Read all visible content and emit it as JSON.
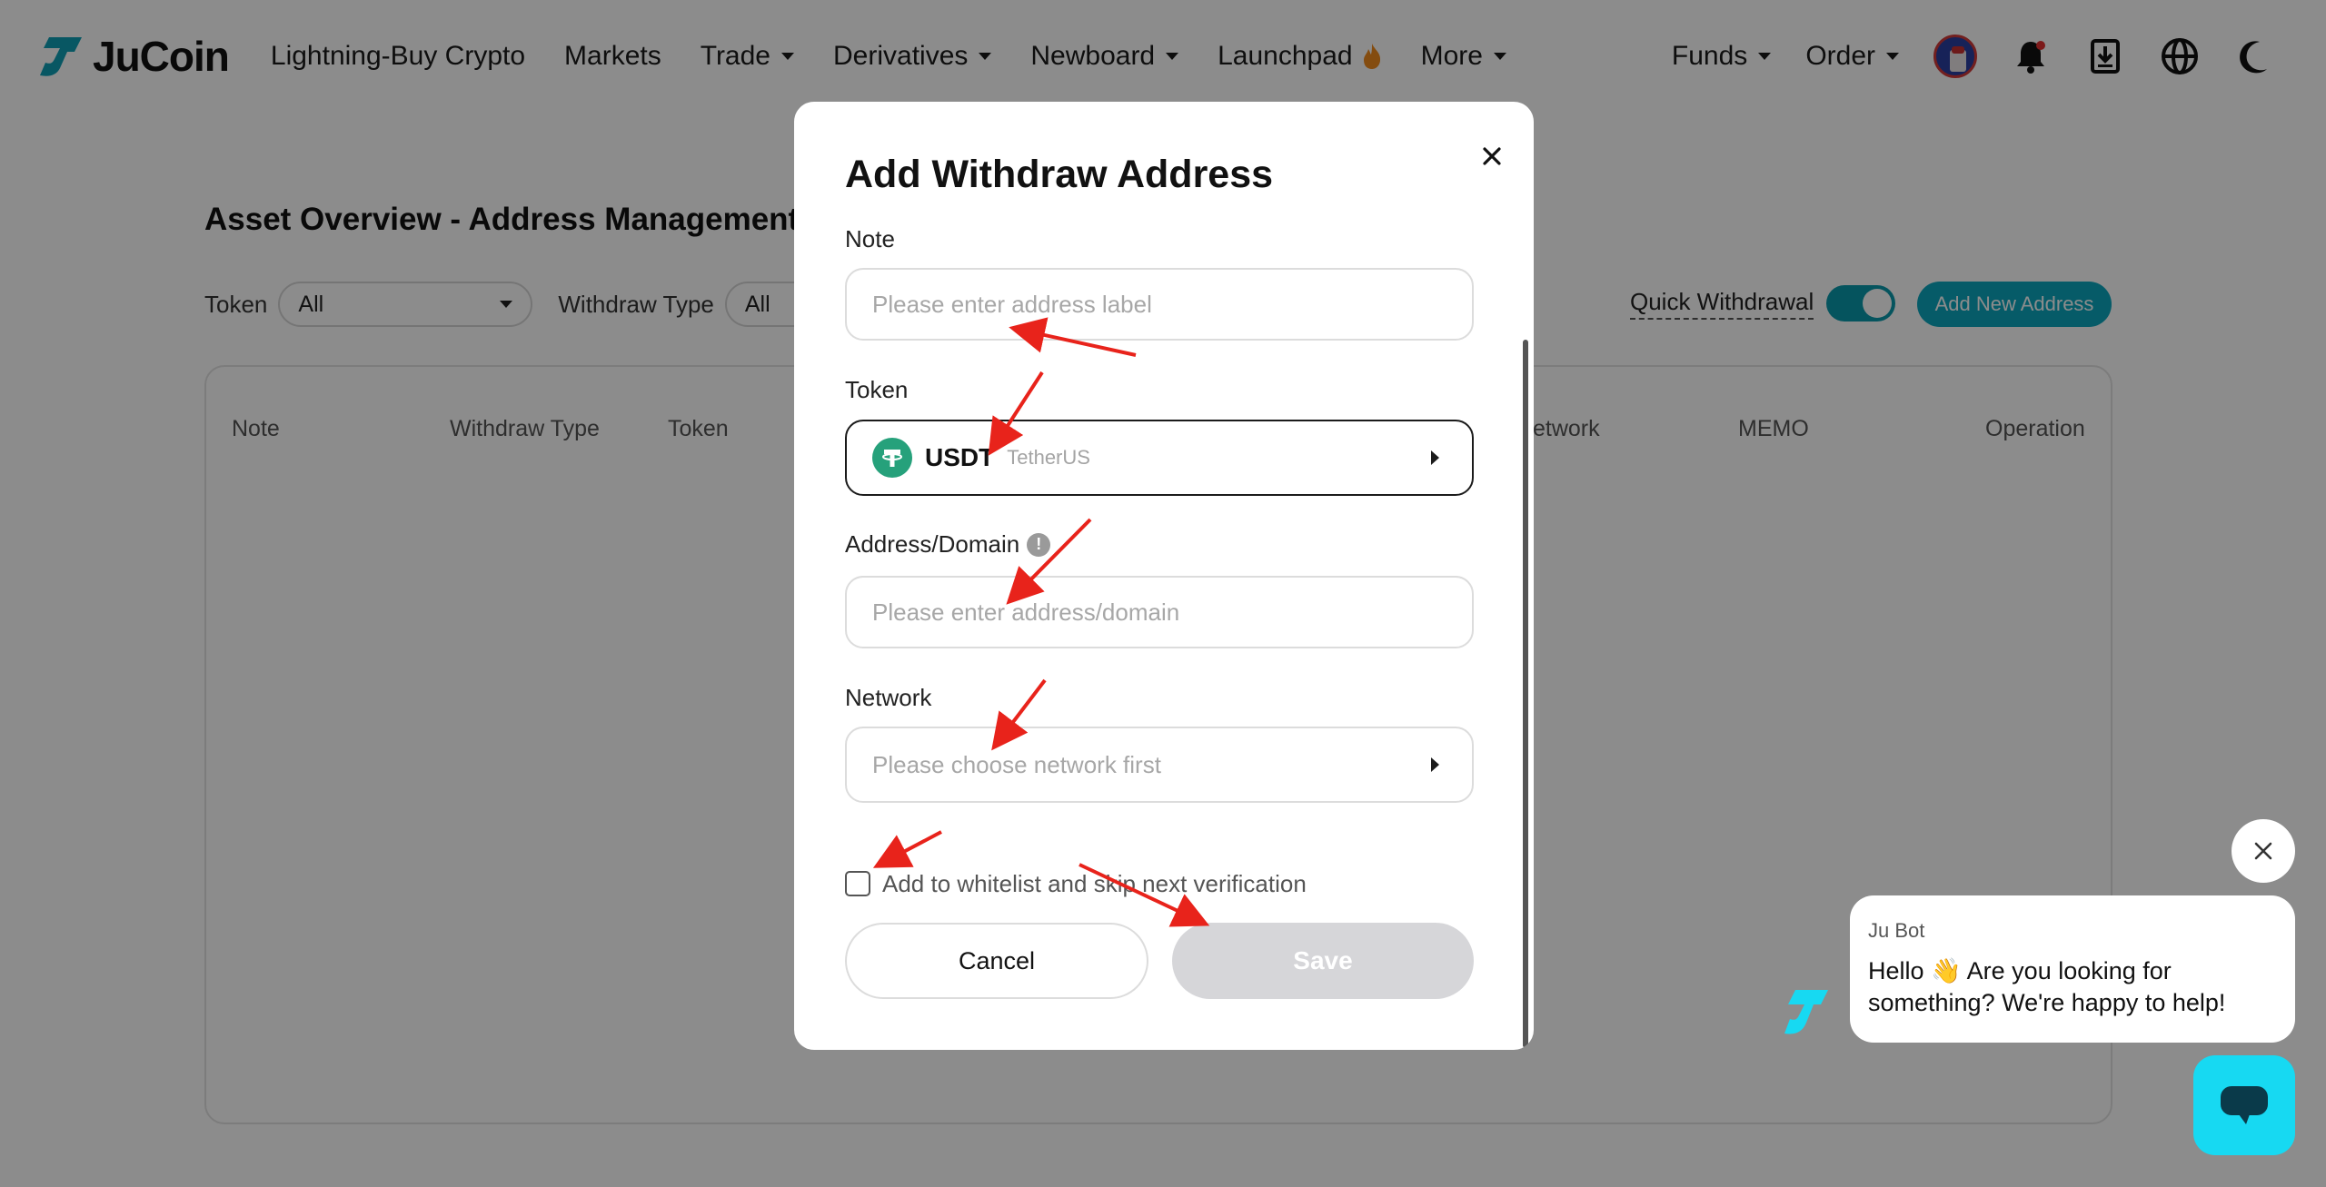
{
  "header": {
    "brand": "JuCoin",
    "nav": [
      {
        "label": "Lightning-Buy Crypto",
        "dropdown": false
      },
      {
        "label": "Markets",
        "dropdown": false
      },
      {
        "label": "Trade",
        "dropdown": true
      },
      {
        "label": "Derivatives",
        "dropdown": true
      },
      {
        "label": "Newboard",
        "dropdown": true
      },
      {
        "label": "Launchpad",
        "dropdown": false
      },
      {
        "label": "More",
        "dropdown": true
      }
    ],
    "right_nav": [
      {
        "label": "Funds"
      },
      {
        "label": "Order"
      }
    ],
    "icons": [
      "avatar",
      "bell-icon",
      "download-icon",
      "globe-icon",
      "moon-icon"
    ]
  },
  "page": {
    "title": "Asset Overview - Address Management",
    "filters": {
      "token_label": "Token",
      "token_value": "All",
      "withdraw_type_label": "Withdraw Type",
      "withdraw_type_value": "All"
    },
    "quick_withdrawal_label": "Quick Withdrawal",
    "quick_withdrawal_on": true,
    "add_new_label": "Add New Address",
    "table_headers": [
      "Note",
      "Withdraw Type",
      "Token",
      "etwork",
      "MEMO",
      "Operation"
    ]
  },
  "modal": {
    "title": "Add Withdraw Address",
    "note_label": "Note",
    "note_placeholder": "Please enter address label",
    "token_label": "Token",
    "token_symbol": "USDT",
    "token_name": "TetherUS",
    "address_label": "Address/Domain",
    "address_placeholder": "Please enter address/domain",
    "network_label": "Network",
    "network_placeholder": "Please choose network first",
    "whitelist_label": "Add to whitelist and skip next verification",
    "cancel_label": "Cancel",
    "save_label": "Save"
  },
  "chat": {
    "bot_name": "Ju Bot",
    "message": "Hello 👋 Are you looking for something? We're happy to help!"
  },
  "colors": {
    "accent": "#0ba6bd",
    "toggle": "#0a9aab",
    "chat_button": "#17d9f2",
    "annotation_arrow": "#e8231b",
    "tether": "#26a17b"
  }
}
